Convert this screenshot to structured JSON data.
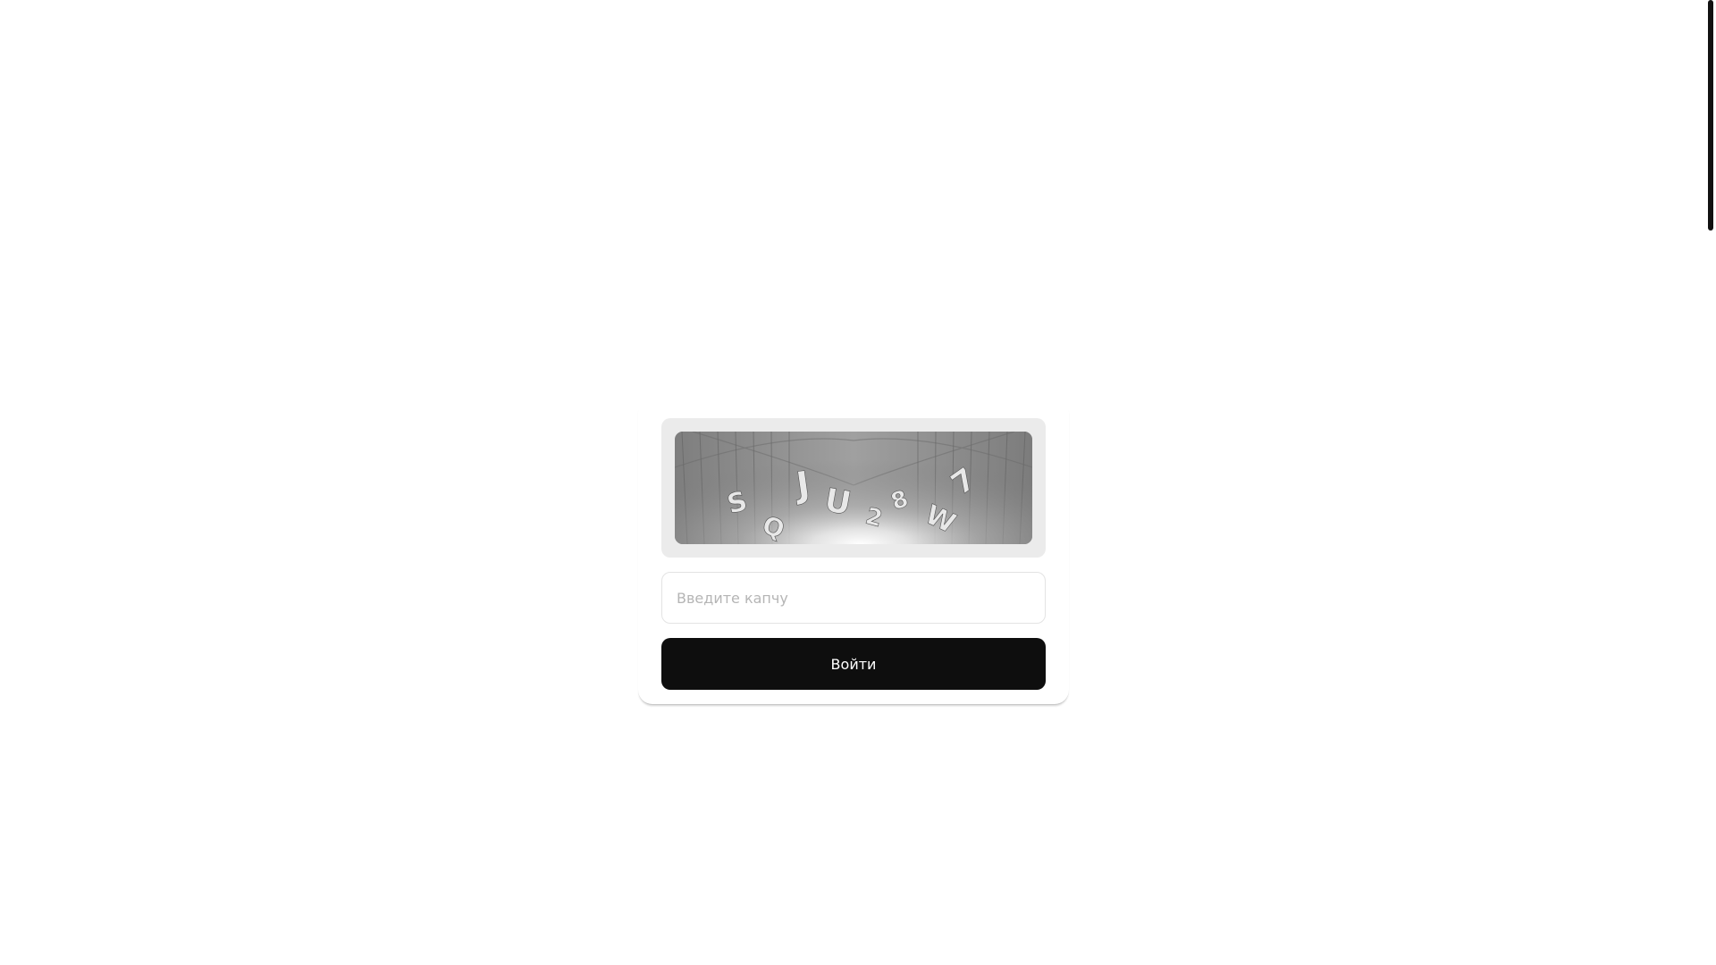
{
  "captcha": {
    "image_text": "SQJU28W7",
    "input_placeholder": "Введите капчу",
    "input_value": ""
  },
  "login": {
    "button_label": "Войти"
  },
  "colors": {
    "background": "#ffffff",
    "button": "#0e0e0e",
    "button_text": "#ffffff",
    "captcha_frame": "#ebebeb",
    "input_border": "#e3e3e3",
    "placeholder": "#b5b5b5",
    "scrollbar_thumb": "#111111"
  }
}
